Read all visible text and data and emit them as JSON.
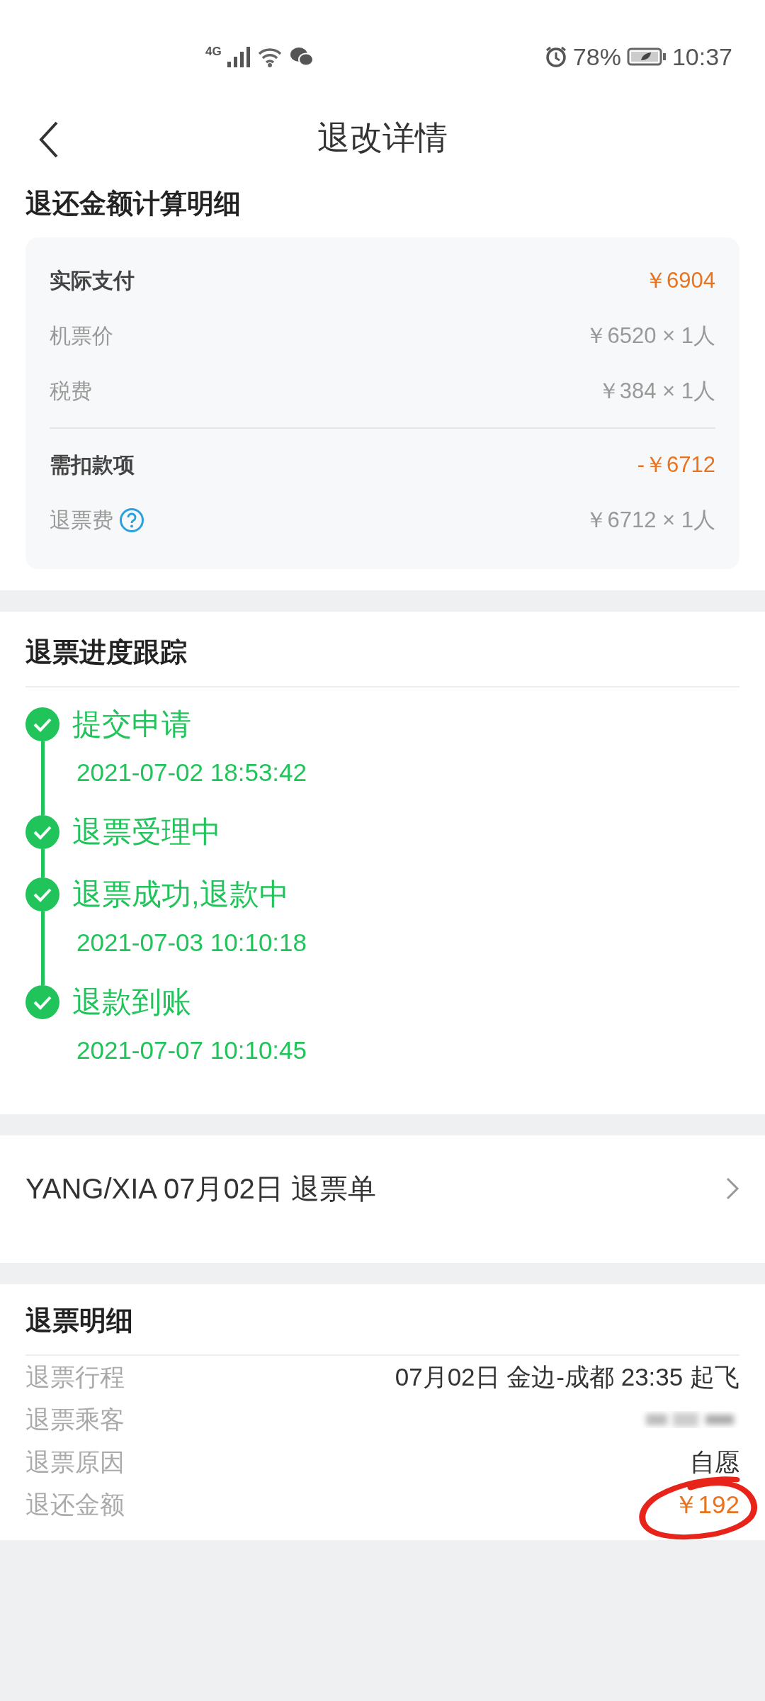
{
  "status_bar": {
    "network": "4G",
    "battery_percent": "78%",
    "time": "10:37"
  },
  "header": {
    "title": "退改详情"
  },
  "calc": {
    "title": "退还金额计算明细",
    "groups": [
      {
        "label": "实际支付",
        "amount": "￥6904",
        "items": [
          {
            "label": "机票价",
            "value": "￥6520 × 1人"
          },
          {
            "label": "税费",
            "value": "￥384 × 1人"
          }
        ]
      },
      {
        "label": "需扣款项",
        "amount": "-￥6712",
        "items": [
          {
            "label": "退票费",
            "value": "￥6712 × 1人",
            "help": true
          }
        ]
      }
    ]
  },
  "progress": {
    "title": "退票进度跟踪",
    "steps": [
      {
        "title": "提交申请",
        "time": "2021-07-02 18:53:42",
        "done": true
      },
      {
        "title": "退票受理中",
        "done": true
      },
      {
        "title": "退票成功,退款中",
        "time": "2021-07-03 10:10:18",
        "done": true
      },
      {
        "title": "退款到账",
        "time": "2021-07-07 10:10:45",
        "done": true
      }
    ]
  },
  "ticket_link": {
    "label": "YANG/XIA 07月02日 退票单"
  },
  "details": {
    "title": "退票明细",
    "rows": [
      {
        "kind": "text",
        "label": "退票行程",
        "value": "07月02日 金边-成都 23:35 起飞"
      },
      {
        "kind": "blurred",
        "label": "退票乘客"
      },
      {
        "kind": "text",
        "label": "退票原因",
        "value": "自愿"
      },
      {
        "kind": "amount",
        "label": "退还金额",
        "value": "￥192",
        "circled": true
      }
    ]
  }
}
